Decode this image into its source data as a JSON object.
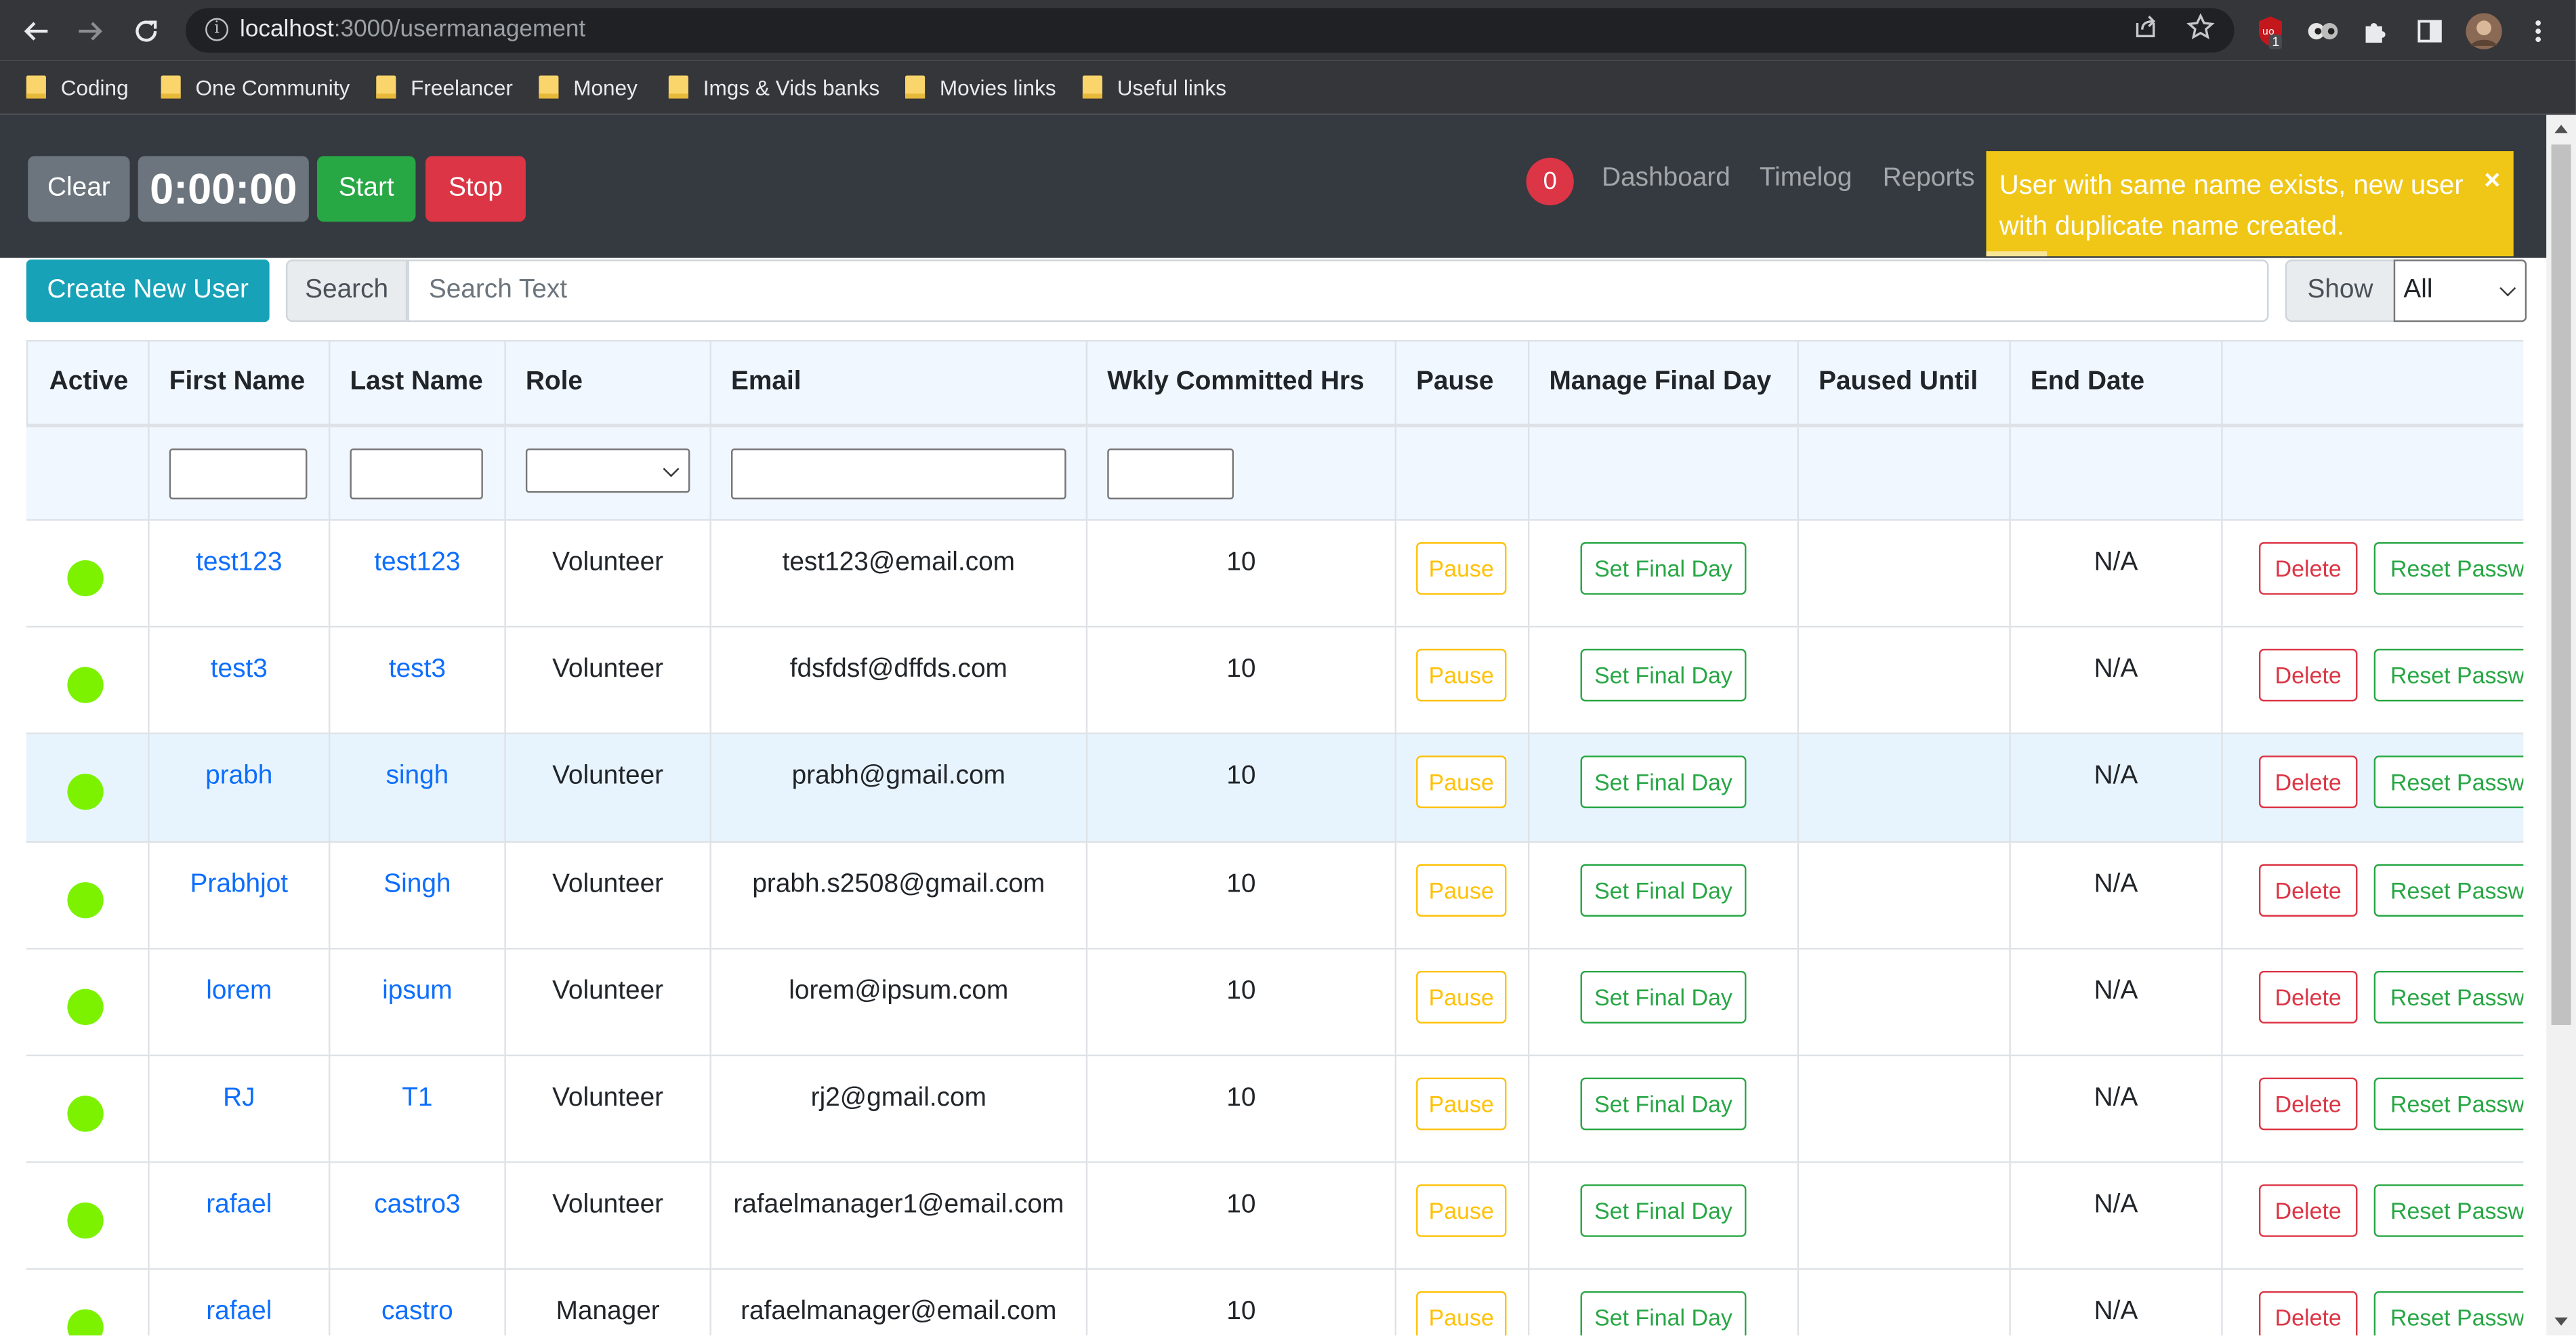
{
  "browser": {
    "url_host": "localhost",
    "url_path": ":3000/usermanagement",
    "bookmarks": [
      "Coding",
      "One Community",
      "Freelancer",
      "Money",
      "Imgs & Vids banks",
      "Movies links",
      "Useful links"
    ],
    "extension_badge": "1"
  },
  "timer": {
    "clear_label": "Clear",
    "time": "0:00:00",
    "start_label": "Start",
    "stop_label": "Stop"
  },
  "nav": {
    "notification_count": "0",
    "links": [
      "Dashboard",
      "Timelog",
      "Reports"
    ]
  },
  "toast": {
    "message": "User with same name exists, new user with duplicate name created.",
    "close": "×"
  },
  "toolbar": {
    "create_label": "Create New User",
    "search_label": "Search",
    "search_placeholder": "Search Text",
    "show_label": "Show",
    "show_value": "All"
  },
  "table": {
    "headers": [
      "Active",
      "First Name",
      "Last Name",
      "Role",
      "Email",
      "Wkly Committed Hrs",
      "Pause",
      "Manage Final Day",
      "Paused Until",
      "End Date"
    ],
    "buttons": {
      "pause": "Pause",
      "final_day": "Set Final Day",
      "delete": "Delete",
      "reset": "Reset Password"
    },
    "rows": [
      {
        "first": "test123",
        "last": "test123",
        "role": "Volunteer",
        "email": "test123@email.com",
        "hrs": "10",
        "end": "N/A"
      },
      {
        "first": "test3",
        "last": "test3",
        "role": "Volunteer",
        "email": "fdsfdsf@dffds.com",
        "hrs": "10",
        "end": "N/A"
      },
      {
        "first": "prabh",
        "last": "singh",
        "role": "Volunteer",
        "email": "prabh@gmail.com",
        "hrs": "10",
        "end": "N/A"
      },
      {
        "first": "Prabhjot",
        "last": "Singh",
        "role": "Volunteer",
        "email": "prabh.s2508@gmail.com",
        "hrs": "10",
        "end": "N/A"
      },
      {
        "first": "lorem",
        "last": "ipsum",
        "role": "Volunteer",
        "email": "lorem@ipsum.com",
        "hrs": "10",
        "end": "N/A"
      },
      {
        "first": "RJ",
        "last": "T1",
        "role": "Volunteer",
        "email": "rj2@gmail.com",
        "hrs": "10",
        "end": "N/A"
      },
      {
        "first": "rafael",
        "last": "castro3",
        "role": "Volunteer",
        "email": "rafaelmanager1@email.com",
        "hrs": "10",
        "end": "N/A"
      },
      {
        "first": "rafael",
        "last": "castro",
        "role": "Manager",
        "email": "rafaelmanager@email.com",
        "hrs": "10",
        "end": "N/A"
      }
    ]
  },
  "colors": {
    "navbar": "#343a40",
    "toast": "#f0c617",
    "active_dot": "#7cf200",
    "info": "#17a2b8",
    "success": "#28a745",
    "danger": "#dc3545",
    "warning": "#ffc107",
    "link": "#0d6efd"
  }
}
